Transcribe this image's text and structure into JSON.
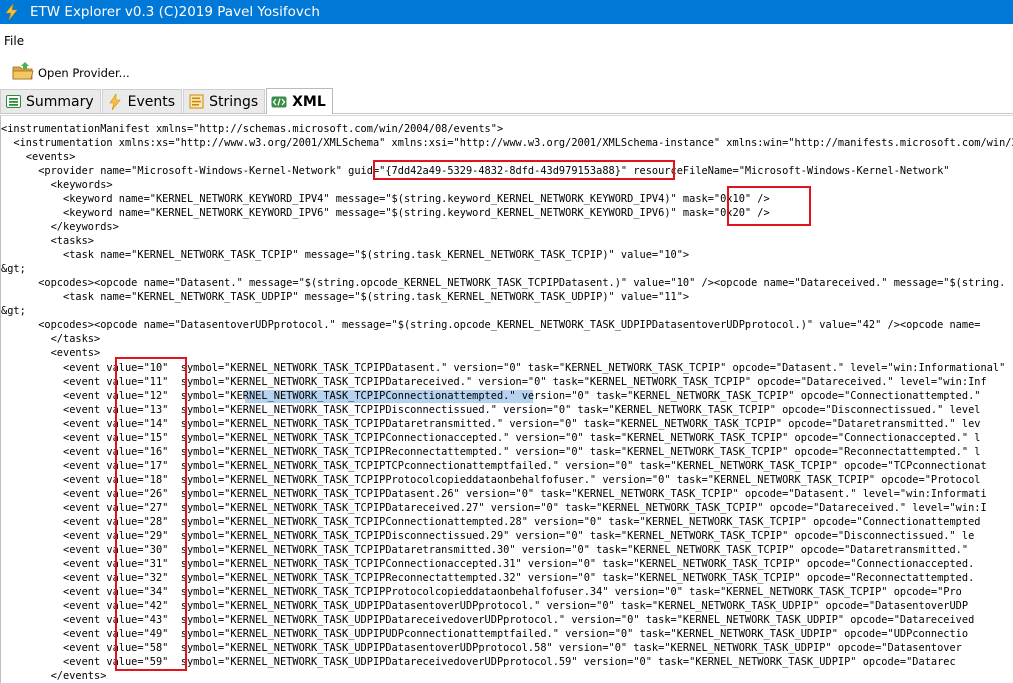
{
  "window": {
    "title": "ETW Explorer v0.3 (C)2019 Pavel Yosifovch"
  },
  "menu": {
    "file_label": "File"
  },
  "toolbar": {
    "open_provider_label": "Open Provider..."
  },
  "tabs": [
    {
      "label": "Summary",
      "icon": "summary-icon"
    },
    {
      "label": "Events",
      "icon": "lightning-icon"
    },
    {
      "label": "Strings",
      "icon": "strings-icon"
    },
    {
      "label": "XML",
      "icon": "xml-icon",
      "active": true
    }
  ],
  "xml": {
    "lines": [
      "<instrumentationManifest xmlns=\"http://schemas.microsoft.com/win/2004/08/events\">",
      "  <instrumentation xmlns:xs=\"http://www.w3.org/2001/XMLSchema\" xmlns:xsi=\"http://www.w3.org/2001/XMLSchema-instance\" xmlns:win=\"http://manifests.microsoft.com/win/2004/08/windows/events\">",
      "    <events>",
      "      <provider name=\"Microsoft-Windows-Kernel-Network\" guid=\"{7dd42a49-5329-4832-8dfd-43d979153a88}\" resourceFileName=\"Microsoft-Windows-Kernel-Network\"",
      "        <keywords>",
      "          <keyword name=\"KERNEL_NETWORK_KEYWORD_IPV4\" message=\"$(string.keyword_KERNEL_NETWORK_KEYWORD_IPV4)\" mask=\"0x10\" />",
      "          <keyword name=\"KERNEL_NETWORK_KEYWORD_IPV6\" message=\"$(string.keyword_KERNEL_NETWORK_KEYWORD_IPV6)\" mask=\"0x20\" />",
      "        </keywords>",
      "        <tasks>",
      "          <task name=\"KERNEL_NETWORK_TASK_TCPIP\" message=\"$(string.task_KERNEL_NETWORK_TASK_TCPIP)\" value=\"10\">",
      "&gt;",
      "      <opcodes><opcode name=\"Datasent.\" message=\"$(string.opcode_KERNEL_NETWORK_TASK_TCPIPDatasent.)\" value=\"10\" /><opcode name=\"Datareceived.\" message=\"$(string.",
      "          <task name=\"KERNEL_NETWORK_TASK_UDPIP\" message=\"$(string.task_KERNEL_NETWORK_TASK_UDPIP)\" value=\"11\">",
      "&gt;",
      "      <opcodes><opcode name=\"DatasentoverUDPprotocol.\" message=\"$(string.opcode_KERNEL_NETWORK_TASK_UDPIPDatasentoverUDPprotocol.)\" value=\"42\" /><opcode name=",
      "        </tasks>",
      "        <events>",
      "          <event value=\"10\"  symbol=\"KERNEL_NETWORK_TASK_TCPIPDatasent.\" version=\"0\" task=\"KERNEL_NETWORK_TASK_TCPIP\" opcode=\"Datasent.\" level=\"win:Informational\"",
      "          <event value=\"11\"  symbol=\"KERNEL_NETWORK_TASK_TCPIPDatareceived.\" version=\"0\" task=\"KERNEL_NETWORK_TASK_TCPIP\" opcode=\"Datareceived.\" level=\"win:Inf",
      "          <event value=\"12\"  symbol=\"KERNEL_NETWORK_TASK_TCPIPConnectionattempted.\" version=\"0\" task=\"KERNEL_NETWORK_TASK_TCPIP\" opcode=\"Connectionattempted.\"",
      "          <event value=\"13\"  symbol=\"KERNEL_NETWORK_TASK_TCPIPDisconnectissued.\" version=\"0\" task=\"KERNEL_NETWORK_TASK_TCPIP\" opcode=\"Disconnectissued.\" level",
      "          <event value=\"14\"  symbol=\"KERNEL_NETWORK_TASK_TCPIPDataretransmitted.\" version=\"0\" task=\"KERNEL_NETWORK_TASK_TCPIP\" opcode=\"Dataretransmitted.\" lev",
      "          <event value=\"15\"  symbol=\"KERNEL_NETWORK_TASK_TCPIPConnectionaccepted.\" version=\"0\" task=\"KERNEL_NETWORK_TASK_TCPIP\" opcode=\"Connectionaccepted.\" l",
      "          <event value=\"16\"  symbol=\"KERNEL_NETWORK_TASK_TCPIPReconnectattempted.\" version=\"0\" task=\"KERNEL_NETWORK_TASK_TCPIP\" opcode=\"Reconnectattempted.\" l",
      "          <event value=\"17\"  symbol=\"KERNEL_NETWORK_TASK_TCPIPTCPconnectionattemptfailed.\" version=\"0\" task=\"KERNEL_NETWORK_TASK_TCPIP\" opcode=\"TCPconnectionat",
      "          <event value=\"18\"  symbol=\"KERNEL_NETWORK_TASK_TCPIPProtocolcopieddataonbehalfofuser.\" version=\"0\" task=\"KERNEL_NETWORK_TASK_TCPIP\" opcode=\"Protocol",
      "          <event value=\"26\"  symbol=\"KERNEL_NETWORK_TASK_TCPIPDatasent.26\" version=\"0\" task=\"KERNEL_NETWORK_TASK_TCPIP\" opcode=\"Datasent.\" level=\"win:Informati",
      "          <event value=\"27\"  symbol=\"KERNEL_NETWORK_TASK_TCPIPDatareceived.27\" version=\"0\" task=\"KERNEL_NETWORK_TASK_TCPIP\" opcode=\"Datareceived.\" level=\"win:I",
      "          <event value=\"28\"  symbol=\"KERNEL_NETWORK_TASK_TCPIPConnectionattempted.28\" version=\"0\" task=\"KERNEL_NETWORK_TASK_TCPIP\" opcode=\"Connectionattempted",
      "          <event value=\"29\"  symbol=\"KERNEL_NETWORK_TASK_TCPIPDisconnectissued.29\" version=\"0\" task=\"KERNEL_NETWORK_TASK_TCPIP\" opcode=\"Disconnectissued.\" le",
      "          <event value=\"30\"  symbol=\"KERNEL_NETWORK_TASK_TCPIPDataretransmitted.30\" version=\"0\" task=\"KERNEL_NETWORK_TASK_TCPIP\" opcode=\"Dataretransmitted.\" ",
      "          <event value=\"31\"  symbol=\"KERNEL_NETWORK_TASK_TCPIPConnectionaccepted.31\" version=\"0\" task=\"KERNEL_NETWORK_TASK_TCPIP\" opcode=\"Connectionaccepted.",
      "          <event value=\"32\"  symbol=\"KERNEL_NETWORK_TASK_TCPIPReconnectattempted.32\" version=\"0\" task=\"KERNEL_NETWORK_TASK_TCPIP\" opcode=\"Reconnectattempted.",
      "          <event value=\"34\"  symbol=\"KERNEL_NETWORK_TASK_TCPIPProtocolcopieddataonbehalfofuser.34\" version=\"0\" task=\"KERNEL_NETWORK_TASK_TCPIP\" opcode=\"Pro",
      "          <event value=\"42\"  symbol=\"KERNEL_NETWORK_TASK_UDPIPDatasentoverUDPprotocol.\" version=\"0\" task=\"KERNEL_NETWORK_TASK_UDPIP\" opcode=\"DatasentoverUDP",
      "          <event value=\"43\"  symbol=\"KERNEL_NETWORK_TASK_UDPIPDatareceivedoverUDPprotocol.\" version=\"0\" task=\"KERNEL_NETWORK_TASK_UDPIP\" opcode=\"Datareceived",
      "          <event value=\"49\"  symbol=\"KERNEL_NETWORK_TASK_UDPIPUDPconnectionattemptfailed.\" version=\"0\" task=\"KERNEL_NETWORK_TASK_UDPIP\" opcode=\"UDPconnectio",
      "          <event value=\"58\"  symbol=\"KERNEL_NETWORK_TASK_UDPIPDatasentoverUDPprotocol.58\" version=\"0\" task=\"KERNEL_NETWORK_TASK_UDPIP\" opcode=\"Datasentover",
      "          <event value=\"59\"  symbol=\"KERNEL_NETWORK_TASK_UDPIPDatareceivedoverUDPprotocol.59\" version=\"0\" task=\"KERNEL_NETWORK_TASK_UDPIP\" opcode=\"Datarec",
      "        </events>"
    ],
    "selected_text": "KERNEL_NETWORK_TASK_TCPIPConnectionattempted"
  },
  "colors": {
    "titlebar": "#0078d7",
    "highlight_box": "#e0141e",
    "selection": "#b8d3f0"
  }
}
